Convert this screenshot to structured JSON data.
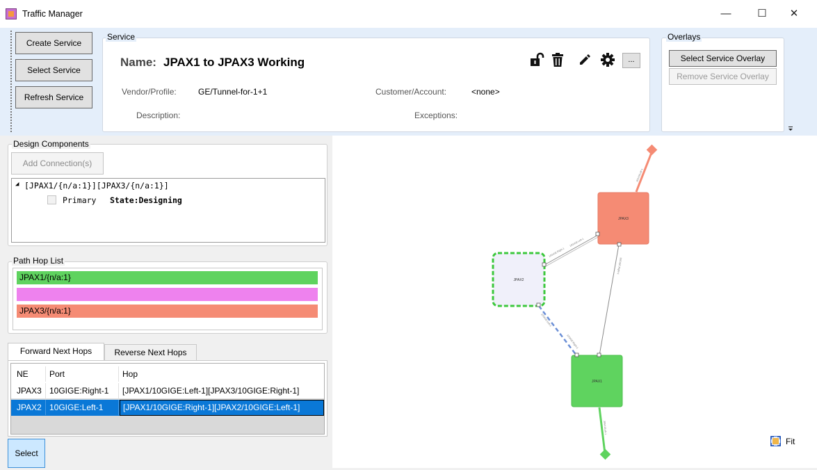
{
  "window": {
    "title": "Traffic Manager",
    "minimize_glyph": "—",
    "maximize_glyph": "☐",
    "close_glyph": "✕"
  },
  "toolbar": {
    "create_service": "Create Service",
    "select_service": "Select Service",
    "refresh_service": "Refresh Service"
  },
  "service": {
    "group_label": "Service",
    "name_label": "Name:",
    "name_value": "JPAX1 to JPAX3 Working",
    "vendor_label": "Vendor/Profile:",
    "vendor_value": "GE/Tunnel-for-1+1",
    "customer_label": "Customer/Account:",
    "customer_value": "<none>",
    "description_label": "Description:",
    "description_value": "",
    "exceptions_label": "Exceptions:",
    "exceptions_value": "",
    "more_label": "...",
    "icons": [
      "unlock-icon",
      "trash-icon",
      "pencil-icon",
      "gear-icon"
    ]
  },
  "overlays": {
    "group_label": "Overlays",
    "select_overlay": "Select Service Overlay",
    "remove_overlay": "Remove Service Overlay"
  },
  "design_components": {
    "group_label": "Design Components",
    "add_connection": "Add Connection(s)",
    "tree_root": "[JPAX1/{n/a:1}][JPAX3/{n/a:1}]",
    "tree_child_label": "Primary",
    "tree_child_state": "State:Designing"
  },
  "path_hop_list": {
    "group_label": "Path Hop List",
    "hops": [
      {
        "label": "JPAX1/{n/a:1}",
        "color": "#5fd35f"
      },
      {
        "label": "",
        "color": "#ee82ee"
      },
      {
        "label": "JPAX3/{n/a:1}",
        "color": "#f58b74"
      }
    ]
  },
  "next_hops": {
    "tabs": [
      "Forward Next Hops",
      "Reverse Next Hops"
    ],
    "active_tab": 0,
    "columns": [
      "NE",
      "Port",
      "Hop"
    ],
    "rows": [
      {
        "ne": "JPAX3",
        "port": "10GIGE:Right-1",
        "hop": "[JPAX1/10GIGE:Left-1][JPAX3/10GIGE:Right-1]"
      },
      {
        "ne": "JPAX2",
        "port": "10GIGE:Left-1",
        "hop": "[JPAX1/10GIGE:Right-1][JPAX2/10GIGE:Left-1]",
        "selected": true
      }
    ],
    "select_button": "Select"
  },
  "topology": {
    "nodes": [
      {
        "id": "JPAX3",
        "label": "JPAX3",
        "color": "#f58b74"
      },
      {
        "id": "JPAX2",
        "label": "JPAX2",
        "color": "#f0f0fa"
      },
      {
        "id": "JPAX1",
        "label": "JPAX1",
        "color": "#5fd35f"
      }
    ],
    "edge_labels": {
      "top_stub": "JPAX3/Left-1",
      "bottom_stub": "JPAX1/Left-1",
      "jpax2_jpax3": "10GIGE:Right-1",
      "jpax2_jpax3_b": "10GIGE:Left-1",
      "jpax3_jpax1": "10GIGE:Right-1",
      "jpax2_jpax1": "10GIGE:Left-1",
      "jpax2_jpax1_b": "10GIGE:Right-1"
    },
    "fit_label": "Fit",
    "colors": {
      "red": "#f58b74",
      "green": "#5fd35f",
      "blue_dash": "#6b8fd6",
      "green_dash": "#3cc83c"
    }
  }
}
